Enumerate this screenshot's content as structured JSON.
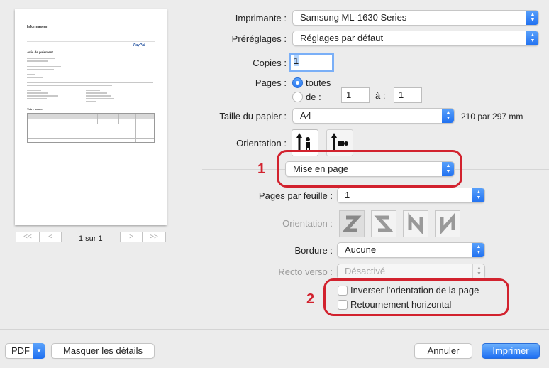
{
  "preview": {
    "company": "Informaseur",
    "paypal_logo": "PayPal",
    "receipt_title": "Avis de paiement",
    "section_title": "Votre panier",
    "page_indicator": "1 sur 1",
    "nav_first": "<<",
    "nav_prev": "<",
    "nav_next": ">",
    "nav_last": ">>"
  },
  "printer": {
    "label": "Imprimante :",
    "value": "Samsung ML-1630 Series"
  },
  "presets": {
    "label": "Préréglages :",
    "value": "Réglages par défaut"
  },
  "copies": {
    "label": "Copies :",
    "value": "1"
  },
  "pages": {
    "label": "Pages :",
    "all_label": "toutes",
    "range_label": "de :",
    "from": "1",
    "to_label": "à :",
    "to": "1"
  },
  "paper_size": {
    "label": "Taille du papier :",
    "value": "A4",
    "dimensions": "210 par 297 mm"
  },
  "orientation": {
    "label": "Orientation :"
  },
  "section": {
    "value": "Mise en page"
  },
  "pages_per_sheet": {
    "label": "Pages par feuille :",
    "value": "1"
  },
  "layout_direction": {
    "label": "Orientation :"
  },
  "border": {
    "label": "Bordure :",
    "value": "Aucune"
  },
  "duplex": {
    "label": "Recto verso :",
    "value": "Désactivé"
  },
  "options": {
    "reverse_orientation": "Inverser l’orientation de la page",
    "flip_horizontal": "Retournement horizontal"
  },
  "annotations": {
    "marker1": "1",
    "marker2": "2"
  },
  "footer": {
    "pdf": "PDF",
    "hide_details": "Masquer les détails",
    "cancel": "Annuler",
    "print": "Imprimer"
  },
  "colors": {
    "accent": "#1d6ef2",
    "annotation": "#d2222e"
  }
}
